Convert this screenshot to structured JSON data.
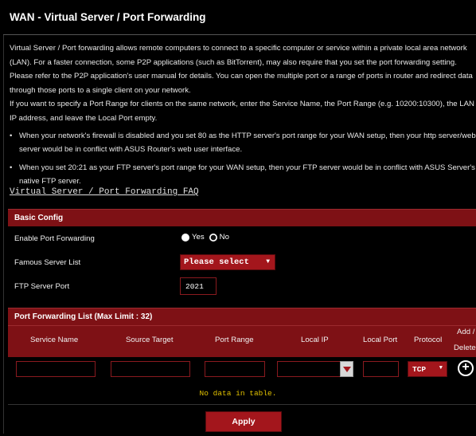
{
  "page": {
    "title": "WAN - Virtual Server / Port Forwarding",
    "description_1": "Virtual Server / Port forwarding allows remote computers to connect to a specific computer or service within a private local area network (LAN). For a faster connection, some P2P applications (such as BitTorrent), may also require that you set the port forwarding setting. Please refer to the P2P application's user manual for details. You can open the multiple port or a range of ports in router and redirect data through those ports to a single client on your network.",
    "description_2": "If you want to specify a Port Range for clients on the same network, enter the Service Name, the Port Range (e.g. 10200:10300), the LAN IP address, and leave the Local Port empty.",
    "bullet_1": "When your network's firewall is disabled and you set 80 as the HTTP server's port range for your WAN setup, then your http server/web server would be in conflict with ASUS Router's web user interface.",
    "bullet_2": "When you set 20:21 as your FTP server's port range for your WAN setup, then your FTP server would be in conflict with ASUS Server's native FTP server.",
    "bullet_symbol": "•",
    "faq_link": "Virtual Server / Port Forwarding FAQ"
  },
  "basic_config": {
    "header": "Basic Config",
    "enable_label": "Enable Port Forwarding",
    "option_yes": "Yes",
    "option_no": "No",
    "selected": "No",
    "famous_label": "Famous Server List",
    "famous_value": "Please select",
    "ftp_label": "FTP Server Port",
    "ftp_value": "2021"
  },
  "port_forwarding": {
    "header": "Port Forwarding List (Max Limit : 32)",
    "columns": [
      "Service Name",
      "Source Target",
      "Port Range",
      "Local IP",
      "Local Port",
      "Protocol",
      "Add /",
      "Delete"
    ],
    "protocol_value": "TCP",
    "empty_message": "No data in table.",
    "caret": "▼",
    "add_glyph": "+"
  },
  "footer": {
    "apply_label": "Apply"
  },
  "colors": {
    "accent": "#7e1115",
    "button": "#a3161c",
    "empty_text": "#e0c000"
  }
}
